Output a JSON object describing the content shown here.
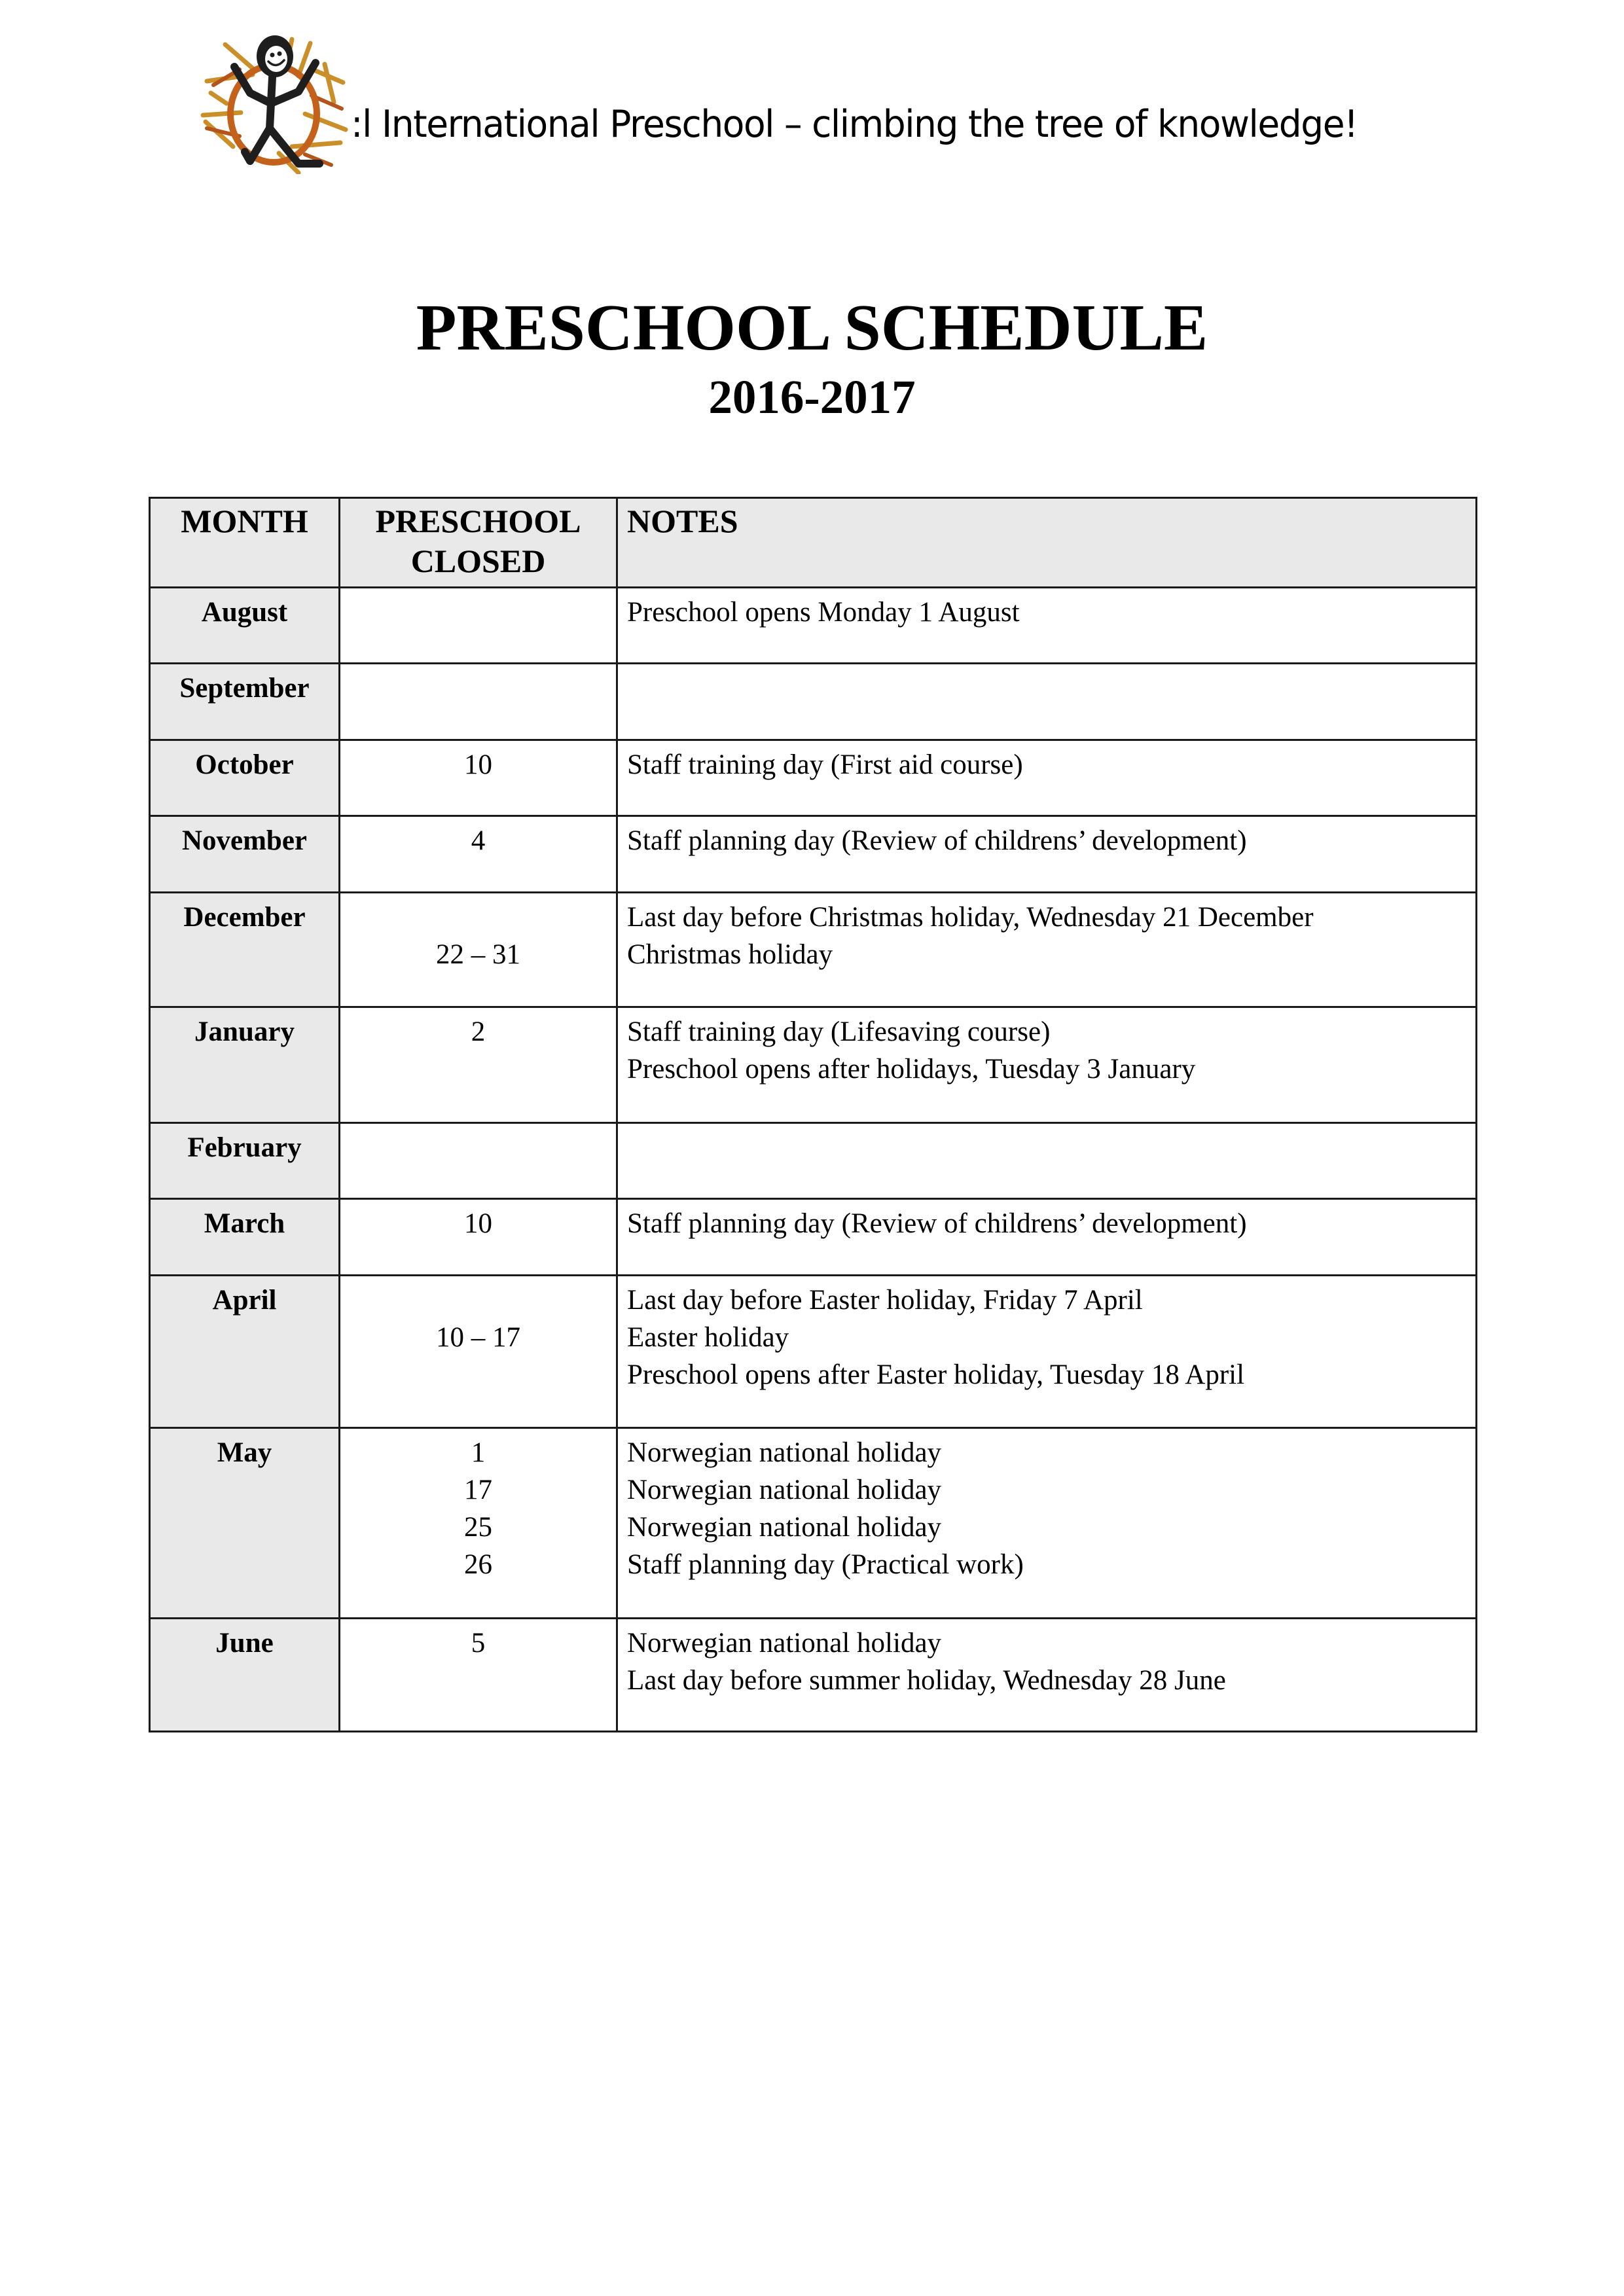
{
  "header": {
    "logo": "stick-figure-sun-logo",
    "tagline": ":l International Preschool – climbing the tree of knowledge!"
  },
  "document": {
    "title": "PRESCHOOL SCHEDULE",
    "subtitle": "2016-2017"
  },
  "colors": {
    "header_fill": "#e9e9e9",
    "month_fill": "#e9e9e9",
    "border": "#1a1a1a",
    "logo_orange": "#c4611b",
    "logo_ochre": "#c98a1e"
  },
  "table": {
    "columns": [
      "MONTH",
      "PRESCHOOL CLOSED",
      "NOTES"
    ],
    "column_lines": {
      "closed": [
        "PRESCHOOL",
        "CLOSED"
      ]
    },
    "rows": [
      {
        "month": "August",
        "closed": [
          ""
        ],
        "notes": [
          "Preschool opens Monday 1 August"
        ]
      },
      {
        "month": "September",
        "closed": [
          ""
        ],
        "notes": [
          ""
        ]
      },
      {
        "month": "October",
        "closed": [
          "10"
        ],
        "notes": [
          "Staff training day (First aid course)"
        ]
      },
      {
        "month": "November",
        "closed": [
          "4"
        ],
        "notes": [
          "Staff planning day (Review of childrens’ development)"
        ]
      },
      {
        "month": "December",
        "closed": [
          "",
          "22 – 31"
        ],
        "notes": [
          "Last day before Christmas holiday, Wednesday 21 December",
          "Christmas holiday"
        ]
      },
      {
        "month": "January",
        "closed": [
          "2"
        ],
        "notes": [
          "Staff training day (Lifesaving course)",
          "Preschool opens after holidays, Tuesday 3 January"
        ]
      },
      {
        "month": "February",
        "closed": [
          ""
        ],
        "notes": [
          ""
        ]
      },
      {
        "month": "March",
        "closed": [
          "10"
        ],
        "notes": [
          "Staff planning day (Review of childrens’ development)"
        ]
      },
      {
        "month": "April",
        "closed": [
          "",
          "10 – 17"
        ],
        "notes": [
          "Last day before Easter holiday, Friday 7 April",
          "Easter holiday",
          "Preschool opens after Easter holiday, Tuesday 18 April"
        ]
      },
      {
        "month": "May",
        "closed": [
          "1",
          "17",
          "25",
          "26"
        ],
        "notes": [
          "Norwegian national holiday",
          "Norwegian national holiday",
          "Norwegian national holiday",
          "Staff planning day (Practical work)"
        ]
      },
      {
        "month": "June",
        "closed": [
          "5"
        ],
        "notes": [
          "Norwegian national holiday",
          "Last day before summer holiday, Wednesday 28 June"
        ]
      }
    ]
  }
}
